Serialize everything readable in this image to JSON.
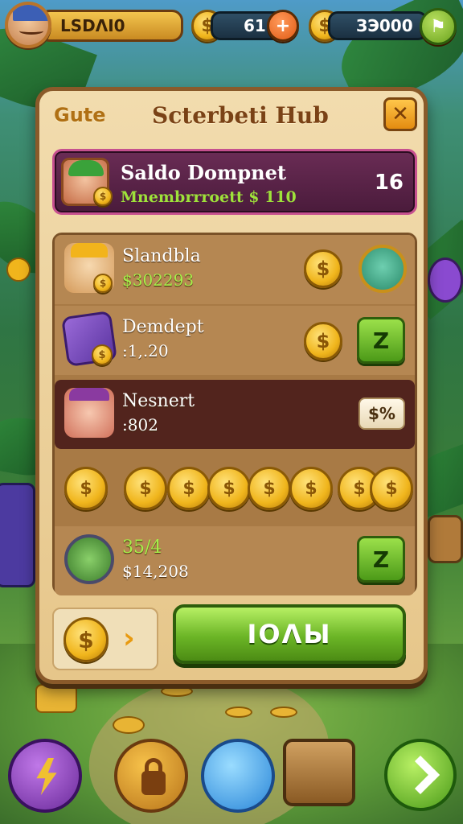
{
  "hud": {
    "player_name": "LSDΛΙ0",
    "coins_value": "61",
    "coin_symbol": "$",
    "plus_symbol": "+",
    "gems_value": "ЗЭ000",
    "shop_symbol": "⚑"
  },
  "panel": {
    "tab_label": "Gute",
    "title": "Scterbeti Hub",
    "close_symbol": "✕",
    "featured": {
      "title": "Saldo Dompnet",
      "subtitle": "Mnembrrroett $ 110",
      "count": "16",
      "coin_symbol": "$"
    },
    "rows": [
      {
        "title": "Slandbla",
        "value": "$302293",
        "coin_symbol": "$"
      },
      {
        "title": "Demdept",
        "value": ":1,.20",
        "coin_symbol": "$",
        "button_label": "Z"
      },
      {
        "title": "Nesnert",
        "value": ":802",
        "button_label": "$%"
      },
      {
        "title": "35/4",
        "value": "$14,208",
        "button_label": "Z"
      }
    ],
    "coin_symbol": "$",
    "arrow_symbol": "›",
    "play_label": "IOΛЫ"
  },
  "colors": {
    "accent_gold": "#f0b51c",
    "button_green": "#6bb526",
    "panel_bg": "#e6c68a",
    "featured_purple": "#4a1b3b"
  },
  "icons": [
    "player-avatar-icon",
    "coin-icon",
    "plus-icon",
    "shop-icon",
    "close-icon",
    "bag-icon",
    "hero-icon",
    "book-icon",
    "recycle-icon",
    "lightning-icon",
    "lock-icon",
    "vase-icon",
    "chest-icon",
    "arrow-icon"
  ]
}
